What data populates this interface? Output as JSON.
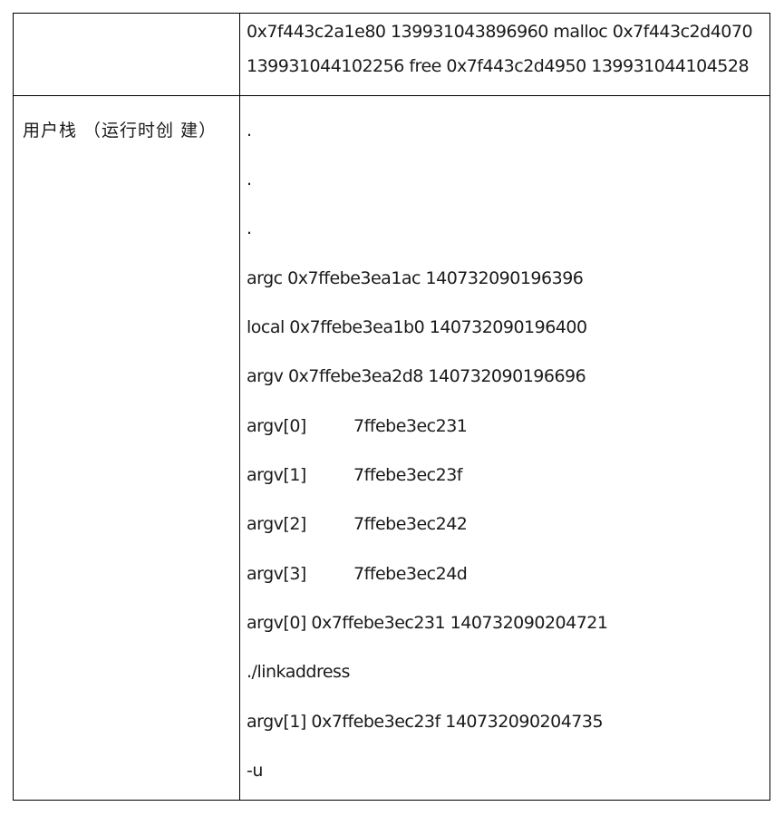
{
  "table": {
    "row1": {
      "left": "",
      "lines": [
        "0x7f443c2a1e80 139931043896960 malloc 0x7f443c2d4070",
        "139931044102256 free 0x7f443c2d4950 139931044104528"
      ]
    },
    "row2": {
      "left": "用户栈 （运行时创 建）",
      "lines": [
        ".",
        ".",
        ".",
        "argc 0x7ffebe3ea1ac 140732090196396",
        "local 0x7ffebe3ea1b0 140732090196400",
        "argv 0x7ffebe3ea2d8 140732090196696"
      ],
      "argv_table": [
        {
          "name": "argv[0]",
          "value": "7ffebe3ec231"
        },
        {
          "name": "argv[1]",
          "value": "7ffebe3ec23f"
        },
        {
          "name": "argv[2]",
          "value": "7ffebe3ec242"
        },
        {
          "name": "argv[3]",
          "value": "7ffebe3ec24d"
        }
      ],
      "tail_lines": [
        "argv[0] 0x7ffebe3ec231 140732090204721",
        "./linkaddress",
        "argv[1] 0x7ffebe3ec23f 140732090204735",
        "-u"
      ]
    }
  }
}
